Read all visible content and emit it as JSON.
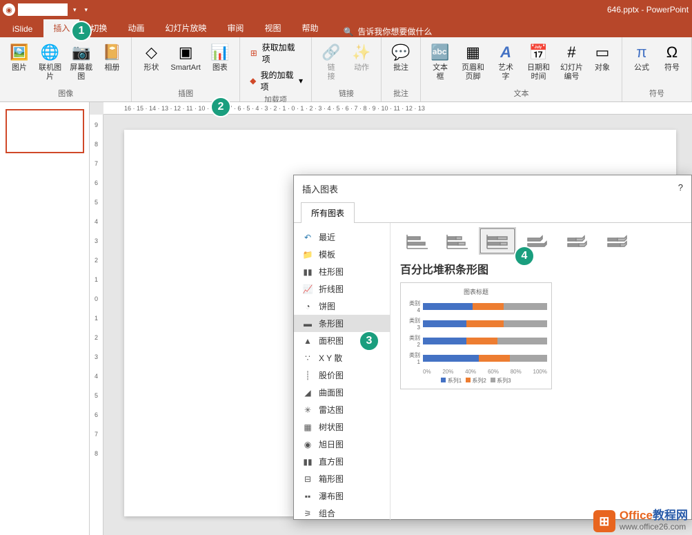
{
  "title": "646.pptx - PowerPoint",
  "tabs": {
    "islide": "iSlide",
    "insert": "插入",
    "transition": "切换",
    "animation": "动画",
    "slideshow": "幻灯片放映",
    "review": "审阅",
    "view": "视图",
    "help": "帮助"
  },
  "tellme": "告诉我你想要做什么",
  "ribbon": {
    "image": {
      "pictures": "图片",
      "online": "联机图片",
      "screenshot": "屏幕截图",
      "album": "相册",
      "label": "图像"
    },
    "illus": {
      "shapes": "形状",
      "smartart": "SmartArt",
      "chart": "图表",
      "label": "插图"
    },
    "addins": {
      "get": "获取加载项",
      "my": "我的加载项",
      "label": "加载项"
    },
    "links": {
      "link": "链\n接",
      "action": "动作",
      "label": "链接"
    },
    "comments": {
      "comment": "批注",
      "label": "批注"
    },
    "text": {
      "textbox": "文本框",
      "headerfooter": "页眉和页脚",
      "wordart": "艺术字",
      "datetime": "日期和时间",
      "slidenum": "幻灯片\n编号",
      "object": "对象",
      "label": "文本"
    },
    "symbols": {
      "equation": "公式",
      "symbol": "符号",
      "label": "符号"
    }
  },
  "dialog": {
    "title": "插入图表",
    "help": "?",
    "tab": "所有图表",
    "cats": {
      "recent": "最近",
      "template": "模板",
      "column": "柱形图",
      "line": "折线图",
      "pie": "饼图",
      "bar": "条形图",
      "area": "面积图",
      "xy": "X Y 散",
      "stock": "股价图",
      "surface": "曲面图",
      "radar": "雷达图",
      "treemap": "树状图",
      "sunburst": "旭日图",
      "histogram": "直方图",
      "boxwhisker": "箱形图",
      "waterfall": "瀑布图",
      "combo": "组合"
    },
    "charttitle": "百分比堆积条形图",
    "preview": {
      "title": "图表标题",
      "rows": [
        "类别 4",
        "类别 3",
        "类别 2",
        "类别 1"
      ],
      "axis": [
        "0%",
        "20%",
        "40%",
        "60%",
        "80%",
        "100%"
      ],
      "legend": [
        "系列1",
        "系列2",
        "系列3"
      ]
    }
  },
  "steps": [
    "1",
    "2",
    "3",
    "4"
  ],
  "watermark": {
    "main1": "Office",
    "main2": "教程网",
    "url": "www.office26.com"
  },
  "chart_data": {
    "type": "bar",
    "stacked": "percent",
    "title": "图表标题",
    "categories": [
      "类别 1",
      "类别 2",
      "类别 3",
      "类别 4"
    ],
    "series": [
      {
        "name": "系列1",
        "values": [
          45,
          35,
          35,
          40
        ]
      },
      {
        "name": "系列2",
        "values": [
          25,
          25,
          30,
          25
        ]
      },
      {
        "name": "系列3",
        "values": [
          30,
          40,
          35,
          35
        ]
      }
    ],
    "xlim": [
      0,
      100
    ],
    "xlabel": "%"
  }
}
